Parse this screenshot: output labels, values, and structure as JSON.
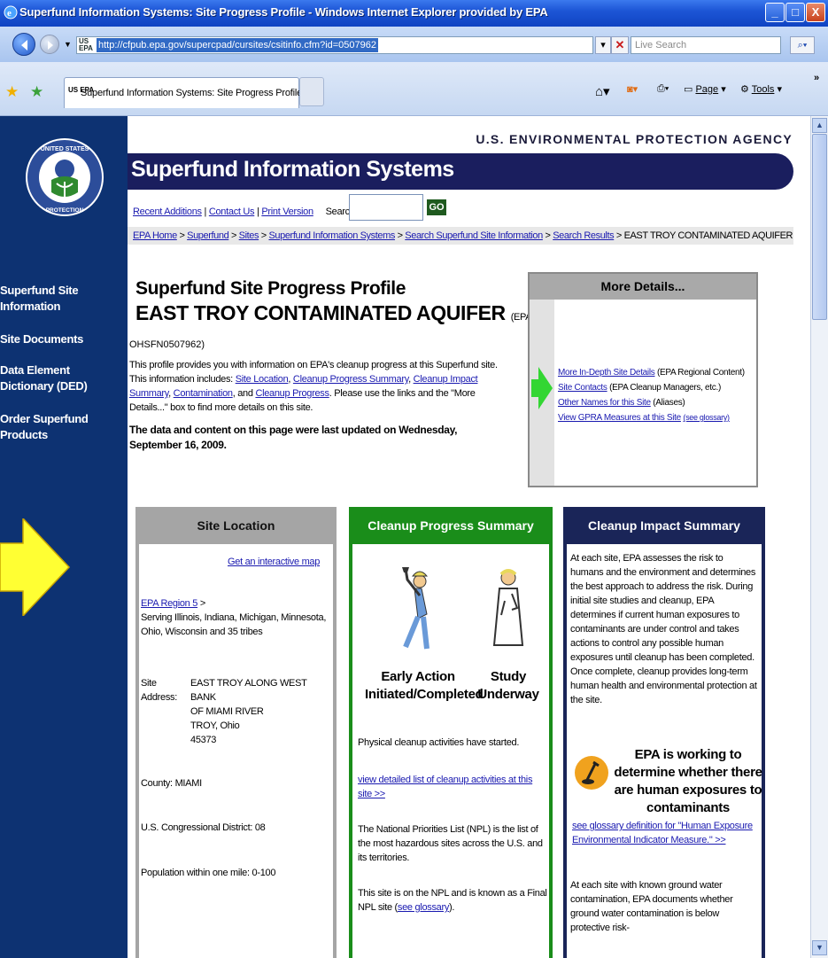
{
  "window": {
    "title": "Superfund Information Systems: Site Progress Profile - Windows Internet Explorer provided by EPA"
  },
  "address_bar": {
    "favicon": "US EPA",
    "url": "http://cfpub.epa.gov/supercpad/cursites/csitinfo.cfm?id=0507962",
    "search_placeholder": "Live Search"
  },
  "tab": {
    "favicon": "US EPA",
    "label": "Superfund Information Systems: Site Progress Profile"
  },
  "commands": {
    "page": "Page",
    "tools": "Tools",
    "overflow": "»"
  },
  "left_nav": {
    "items": [
      "Superfund Site Information",
      "Site Documents",
      "Data Element Dictionary (DED)",
      "Order Superfund Products"
    ]
  },
  "header": {
    "agency": "U.S. ENVIRONMENTAL PROTECTION AGENCY",
    "banner": "Superfund Information Systems",
    "util_links": [
      "Recent Additions",
      "Contact Us",
      "Print Version"
    ],
    "search_label": "Search:",
    "go": "GO",
    "breadcrumbs": [
      "EPA Home",
      "Superfund",
      "Sites",
      "Superfund Information Systems",
      "Search Superfund Site Information",
      "Search Results"
    ],
    "breadcrumb_current": "EAST TROY CONTAMINATED AQUIFER"
  },
  "profile": {
    "heading": "Superfund Site Progress Profile",
    "site_name": "EAST TROY CONTAMINATED AQUIFER",
    "epa_id_label": "(EPA ID:",
    "epa_id_value": "OHSFN0507962)",
    "intro": "This profile provides you with information on EPA's cleanup progress at this Superfund site. This information includes:",
    "intro_links": [
      "Site Location",
      "Cleanup Progress Summary",
      "Cleanup Impact Summary",
      "Contamination",
      "Cleanup Progress"
    ],
    "intro_and": "and",
    "intro_tail": ". Please use the links and the \"More Details...\" box to find more details on this site.",
    "updated": "The data and content on this page were last updated on Wednesday, September 16, 2009."
  },
  "more_details": {
    "title": "More Details...",
    "links": [
      {
        "text": "More In-Depth Site Details",
        "note": "(EPA Regional Content)"
      },
      {
        "text": "Site Contacts",
        "note": "(EPA Cleanup Managers, etc.)"
      },
      {
        "text": "Other Names for this Site",
        "note": "(Aliases)"
      },
      {
        "text": "View GPRA Measures at this Site",
        "note": "(see glossary)"
      }
    ]
  },
  "site_location": {
    "title": "Site Location",
    "map_link": "Get an interactive map",
    "region_link": "EPA Region 5",
    "region_sep": ">",
    "serving": "Serving Illinois, Indiana, Michigan, Minnesota, Ohio, Wisconsin and 35 tribes",
    "address_label_1": "Site",
    "address_label_2": "Address:",
    "address_lines": [
      "EAST TROY ALONG WEST BANK",
      "OF MIAMI RIVER",
      "TROY, Ohio",
      "45373"
    ],
    "county": "County: MIAMI",
    "district": "U.S. Congressional District: 08",
    "population": "Population within one mile: 0-100"
  },
  "cleanup_progress": {
    "title": "Cleanup Progress Summary",
    "status_1": "Early Action Initiated/Completed",
    "status_2": "Study Underway",
    "activity": "Physical cleanup activities have started.",
    "activity_link": "view detailed list of cleanup activities at this site >>",
    "npl_text": "The National Priorities List (NPL) is the list of the most hazardous sites across the U.S. and its territories.",
    "npl_status": "This site is on the NPL and is known as a Final NPL site",
    "glossary_link": "see glossary"
  },
  "cleanup_impact": {
    "title": "Cleanup Impact Summary",
    "paragraph": "At each site, EPA assesses the risk to humans and the environment and determines the best approach to address the risk. During initial site studies and cleanup, EPA determines if current human exposures to contaminants are under control and takes actions to control any possible human exposures until cleanup has been completed. Once complete, cleanup provides long-term human health and environmental protection at the site.",
    "status": "EPA is working to determine whether there are human exposures to contaminants",
    "glossary_link": "see glossary definition for \"Human Exposure Environmental Indicator Measure.\" >>",
    "groundwater": "At each site with known ground water contamination, EPA documents whether ground water contamination is below protective risk-"
  }
}
